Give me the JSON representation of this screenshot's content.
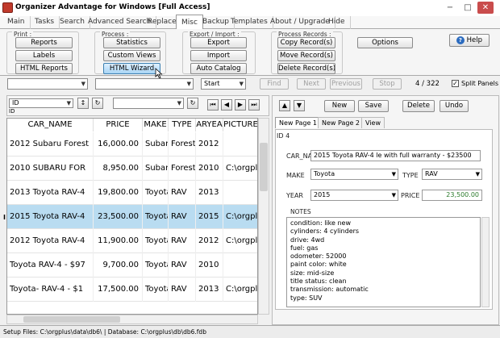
{
  "window": {
    "title": "Organizer Advantage for Windows [Full Access]",
    "min": "−",
    "max": "□",
    "close": "✕"
  },
  "menu": [
    "Main",
    "Tasks",
    "Search",
    "Advanced Search",
    "Replace",
    "Misc",
    "Backup",
    "Templates",
    "About / Upgrade",
    "Hide"
  ],
  "ribbon": {
    "print": {
      "label": "Print :",
      "buttons": [
        "Reports",
        "Labels",
        "HTML Reports"
      ]
    },
    "process": {
      "label": "Process :",
      "buttons": [
        "Statistics",
        "Custom Views",
        "HTML Wizard"
      ]
    },
    "exim": {
      "label": "Export / Import :",
      "buttons": [
        "Export",
        "Import",
        "Auto Catalog"
      ]
    },
    "records": {
      "label": "Process Records :",
      "buttons": [
        "Copy Record(s)",
        "Move Record(s)",
        "Delete Record(s)"
      ]
    },
    "options": "Options",
    "help": "Help"
  },
  "toolbar": {
    "start": "Start",
    "find": "Find",
    "next": "Next",
    "previous": "Previous",
    "stop": "Stop",
    "count": "4 / 322",
    "split": "Split Panels"
  },
  "grid": {
    "field": "ID",
    "field_sub": "ID",
    "columns": [
      "CAR_NAME",
      "PRICE",
      "MAKE",
      "TYPE",
      "ARYEA",
      "PICTURE"
    ],
    "rows": [
      {
        "name": "2012 Subaru Forest",
        "price": "16,000.00",
        "make": "Subaru",
        "type": "Foreste",
        "year": "2012",
        "pic": "",
        "sel": false
      },
      {
        "name": "2010 SUBARU FOR",
        "price": "8,950.00",
        "make": "Subaru",
        "type": "Foreste",
        "year": "2010",
        "pic": "C:\\orgplu",
        "sel": false
      },
      {
        "name": "2013 Toyota RAV-4",
        "price": "19,800.00",
        "make": "Toyota",
        "type": "RAV",
        "year": "2013",
        "pic": "",
        "sel": false
      },
      {
        "name": "2015 Toyota RAV-4",
        "price": "23,500.00",
        "make": "Toyota",
        "type": "RAV",
        "year": "2015",
        "pic": "C:\\orgplu",
        "sel": true
      },
      {
        "name": "2012 Toyota RAV-4",
        "price": "11,900.00",
        "make": "Toyota",
        "type": "RAV",
        "year": "2012",
        "pic": "C:\\orgplu",
        "sel": false
      },
      {
        "name": "Toyota RAV-4 - $97",
        "price": "9,700.00",
        "make": "Toyota",
        "type": "RAV",
        "year": "2010",
        "pic": "",
        "sel": false
      },
      {
        "name": "Toyota- RAV-4 - $1",
        "price": "17,500.00",
        "make": "Toyota",
        "type": "RAV",
        "year": "2013",
        "pic": "C:\\orgplu",
        "sel": false
      }
    ]
  },
  "panel": {
    "new": "New",
    "save": "Save",
    "delete": "Delete",
    "undo": "Undo",
    "tabs": [
      "New Page 1",
      "New Page 2",
      "View"
    ],
    "id": "ID 4",
    "car_label": "CAR_NA",
    "car_value": "2015 Toyota RAV-4 le with full warranty - $23500",
    "make_label": "MAKE",
    "make_value": "Toyota",
    "type_label": "TYPE",
    "type_value": "RAV",
    "year_label": "YEAR",
    "year_value": "2015",
    "price_label": "PRICE",
    "price_value": "23,500.00",
    "notes_label": "NOTES",
    "notes": [
      "condition: like new",
      "cylinders: 4 cylinders",
      "drive: 4wd",
      "fuel: gas",
      "odometer: 52000",
      "paint color: white",
      "size: mid-size",
      "title status: clean",
      "transmission: automatic",
      "type: SUV"
    ]
  },
  "status": "Setup Files: C:\\orgplus\\data\\db6\\ | Database: C:\\orgplus\\db\\db6.fdb"
}
